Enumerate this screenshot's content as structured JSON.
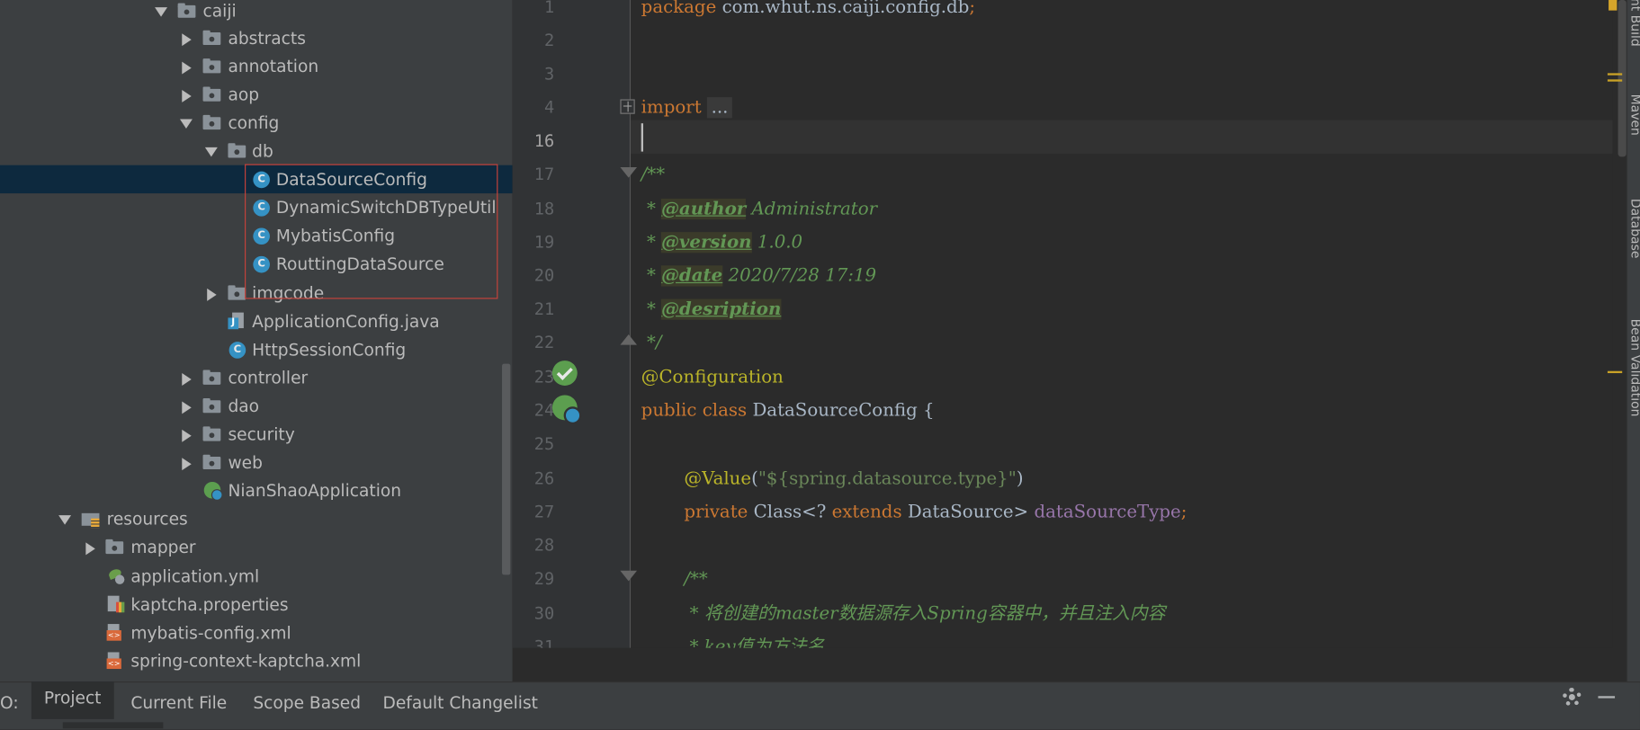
{
  "project_tree": {
    "items": [
      {
        "label": "caiji",
        "type": "folder",
        "expanded": true
      },
      {
        "label": "abstracts",
        "type": "folder",
        "expanded": false
      },
      {
        "label": "annotation",
        "type": "folder",
        "expanded": false
      },
      {
        "label": "aop",
        "type": "folder",
        "expanded": false
      },
      {
        "label": "config",
        "type": "folder",
        "expanded": true
      },
      {
        "label": "db",
        "type": "folder",
        "expanded": true
      },
      {
        "label": "DataSourceConfig",
        "type": "class",
        "selected": true
      },
      {
        "label": "DynamicSwitchDBTypeUtil",
        "type": "class"
      },
      {
        "label": "MybatisConfig",
        "type": "class"
      },
      {
        "label": "RouttingDataSource",
        "type": "class"
      },
      {
        "label": "imgcode",
        "type": "folder",
        "expanded": false
      },
      {
        "label": "ApplicationConfig.java",
        "type": "java-file"
      },
      {
        "label": "HttpSessionConfig",
        "type": "class"
      },
      {
        "label": "controller",
        "type": "folder",
        "expanded": false
      },
      {
        "label": "dao",
        "type": "folder",
        "expanded": false
      },
      {
        "label": "security",
        "type": "folder",
        "expanded": false
      },
      {
        "label": "web",
        "type": "folder",
        "expanded": false
      },
      {
        "label": "NianShaoApplication",
        "type": "spring-class"
      },
      {
        "label": "resources",
        "type": "resources-folder",
        "expanded": true
      },
      {
        "label": "mapper",
        "type": "folder",
        "expanded": false
      },
      {
        "label": "application.yml",
        "type": "yml-file"
      },
      {
        "label": "kaptcha.properties",
        "type": "properties-file"
      },
      {
        "label": "mybatis-config.xml",
        "type": "xml-file"
      },
      {
        "label": "spring-context-kaptcha.xml",
        "type": "xml-file"
      }
    ],
    "class_icon_letter": "C"
  },
  "editor": {
    "line_numbers": [
      "1",
      "2",
      "3",
      "4",
      "16",
      "17",
      "18",
      "19",
      "20",
      "21",
      "22",
      "23",
      "24",
      "25",
      "26",
      "27",
      "28",
      "29",
      "30",
      "31"
    ],
    "current_line": "16",
    "code": {
      "l1_kw": "package",
      "l1_rest": " com.whut.ns.caiji.config.db",
      "l1_semi": ";",
      "l4_kw": "import",
      "l4_dots": "...",
      "l17": "/**",
      "l18_star": " * ",
      "l18_tag": "@author",
      "l18_rest": " Administrator",
      "l19_star": " * ",
      "l19_tag": "@version",
      "l19_rest": " 1.0.0",
      "l20_star": " * ",
      "l20_tag": "@date",
      "l20_rest": " 2020/7/28 17:19",
      "l21_star": " * ",
      "l21_tag": "@desription",
      "l22": " */",
      "l23": "@Configuration",
      "l24_kw": "public class",
      "l24_rest": " DataSourceConfig {",
      "l26_ann": "@Value",
      "l26_open": "(",
      "l26_str": "\"${spring.datasource.type}\"",
      "l26_close": ")",
      "l27_kw": "private",
      "l27_mid": " Class<? ",
      "l27_kw2": "extends",
      "l27_type": " DataSource> ",
      "l27_field": "dataSourceType",
      "l27_semi": ";",
      "l29": "/**",
      "l30": " * 将创建的master数据源存入Spring容器中，并且注入内容",
      "l31": " * key值为方法名"
    }
  },
  "right_toolbar": {
    "items": [
      "Ant Build",
      "Maven",
      "Database",
      "Bean Validation"
    ]
  },
  "bottom_bar": {
    "prefix": "O:",
    "tabs": [
      "Project",
      "Current File",
      "Scope Based",
      "Default Changelist"
    ],
    "active_tab": "Project"
  },
  "colors": {
    "keyword": "#cc7832",
    "annotation": "#bbb529",
    "string": "#6a8759",
    "doc_comment": "#629755",
    "field": "#9876aa",
    "selection": "#0d293e",
    "highlight_box": "#c7423b"
  }
}
